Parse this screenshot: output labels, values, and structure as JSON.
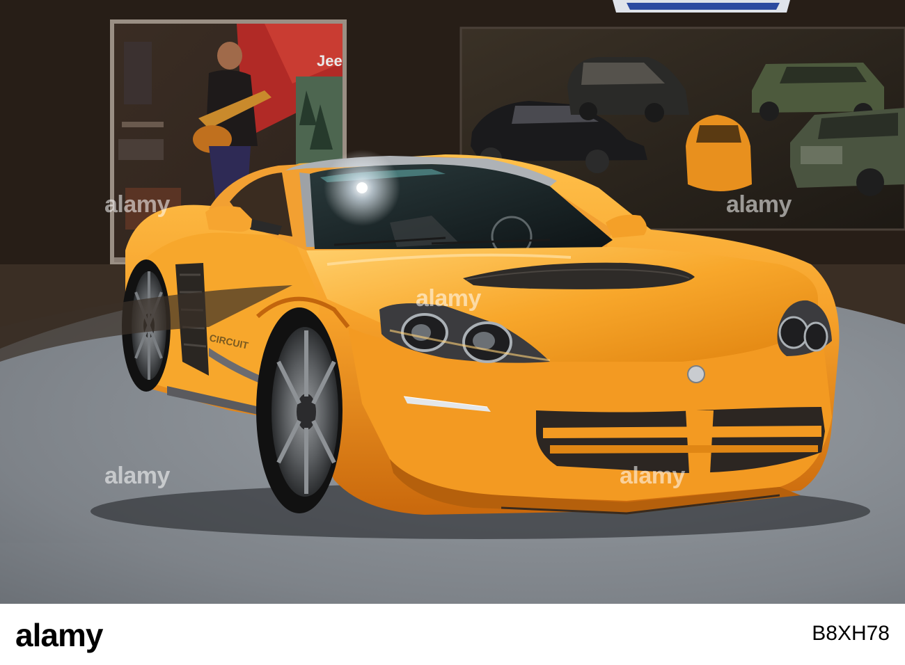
{
  "watermark": {
    "text": "alamy",
    "color": "rgba(255,255,255,0.55)"
  },
  "stock_bar": {
    "logo_text": "alamy",
    "image_id": "B8XH78",
    "background": "#ffffff"
  },
  "display_case": {
    "brand_text": "Jee"
  },
  "car": {
    "side_decal_text": "CIRCUIT",
    "body_color": "#f59a1b"
  }
}
